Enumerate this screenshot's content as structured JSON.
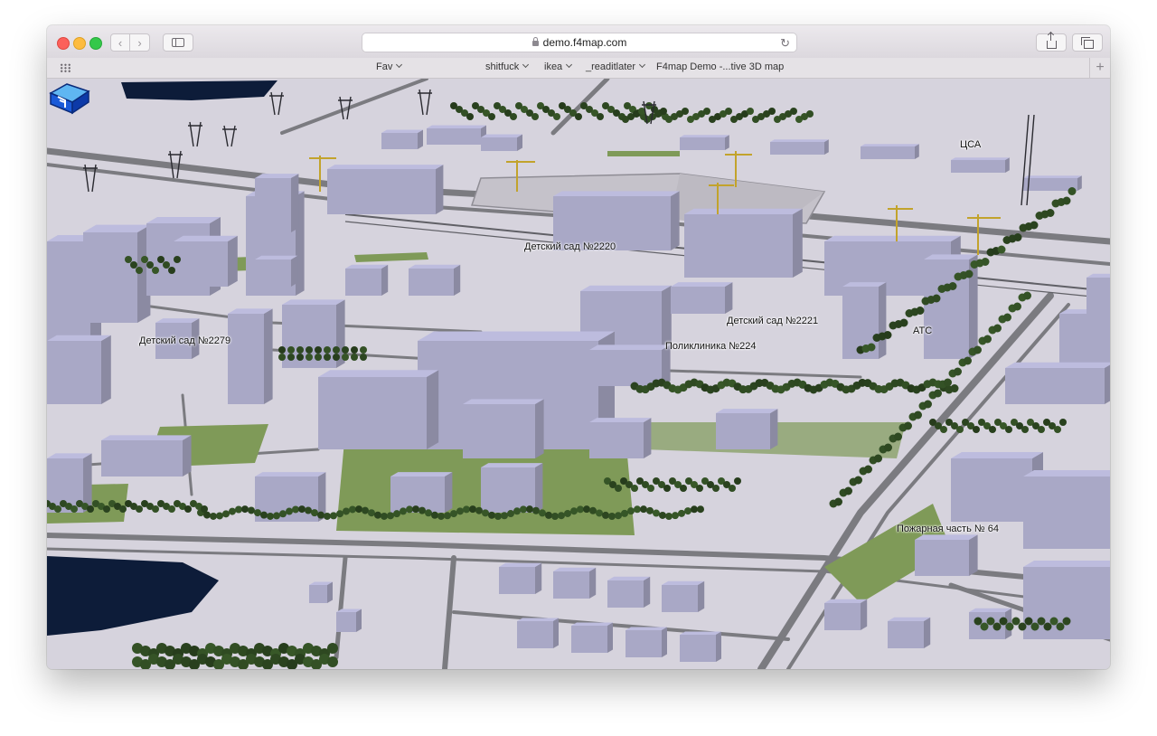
{
  "browser": {
    "url": "demo.f4map.com",
    "favorites": [
      {
        "label": "Fav",
        "has_menu": true
      },
      {
        "label": "shitfuck",
        "has_menu": true
      },
      {
        "label": "ikea",
        "has_menu": true
      },
      {
        "label": "_readitlater",
        "has_menu": true
      },
      {
        "label": "F4map Demo -...tive 3D map",
        "has_menu": false
      }
    ]
  },
  "map": {
    "labels": {
      "cca": "ЦСА",
      "kindergarten_2220": "Детский сад №2220",
      "kindergarten_2221": "Детский сад №2221",
      "kindergarten_2279": "Детский сад №2279",
      "polyclinic_224": "Поликлиника №224",
      "atc": "АТС",
      "fire_station_64": "Пожарная часть № 64"
    },
    "colors": {
      "ground": "#d6d3dd",
      "building": "#a9a8c6",
      "road": "#7b7b80",
      "grass": "#7f9a58",
      "tree": "#2f4a22",
      "water": "#0d1c39",
      "crane": "#c2a32c"
    }
  },
  "icons": {
    "logo": "f4map-cube-logo",
    "back": "chevron-left-icon",
    "forward": "chevron-right-icon",
    "sidebar": "sidebar-icon",
    "lock": "lock-icon",
    "reload": "reload-icon",
    "share": "share-icon",
    "tabs": "tabs-icon",
    "grid": "grid-icon",
    "add": "plus-icon"
  }
}
